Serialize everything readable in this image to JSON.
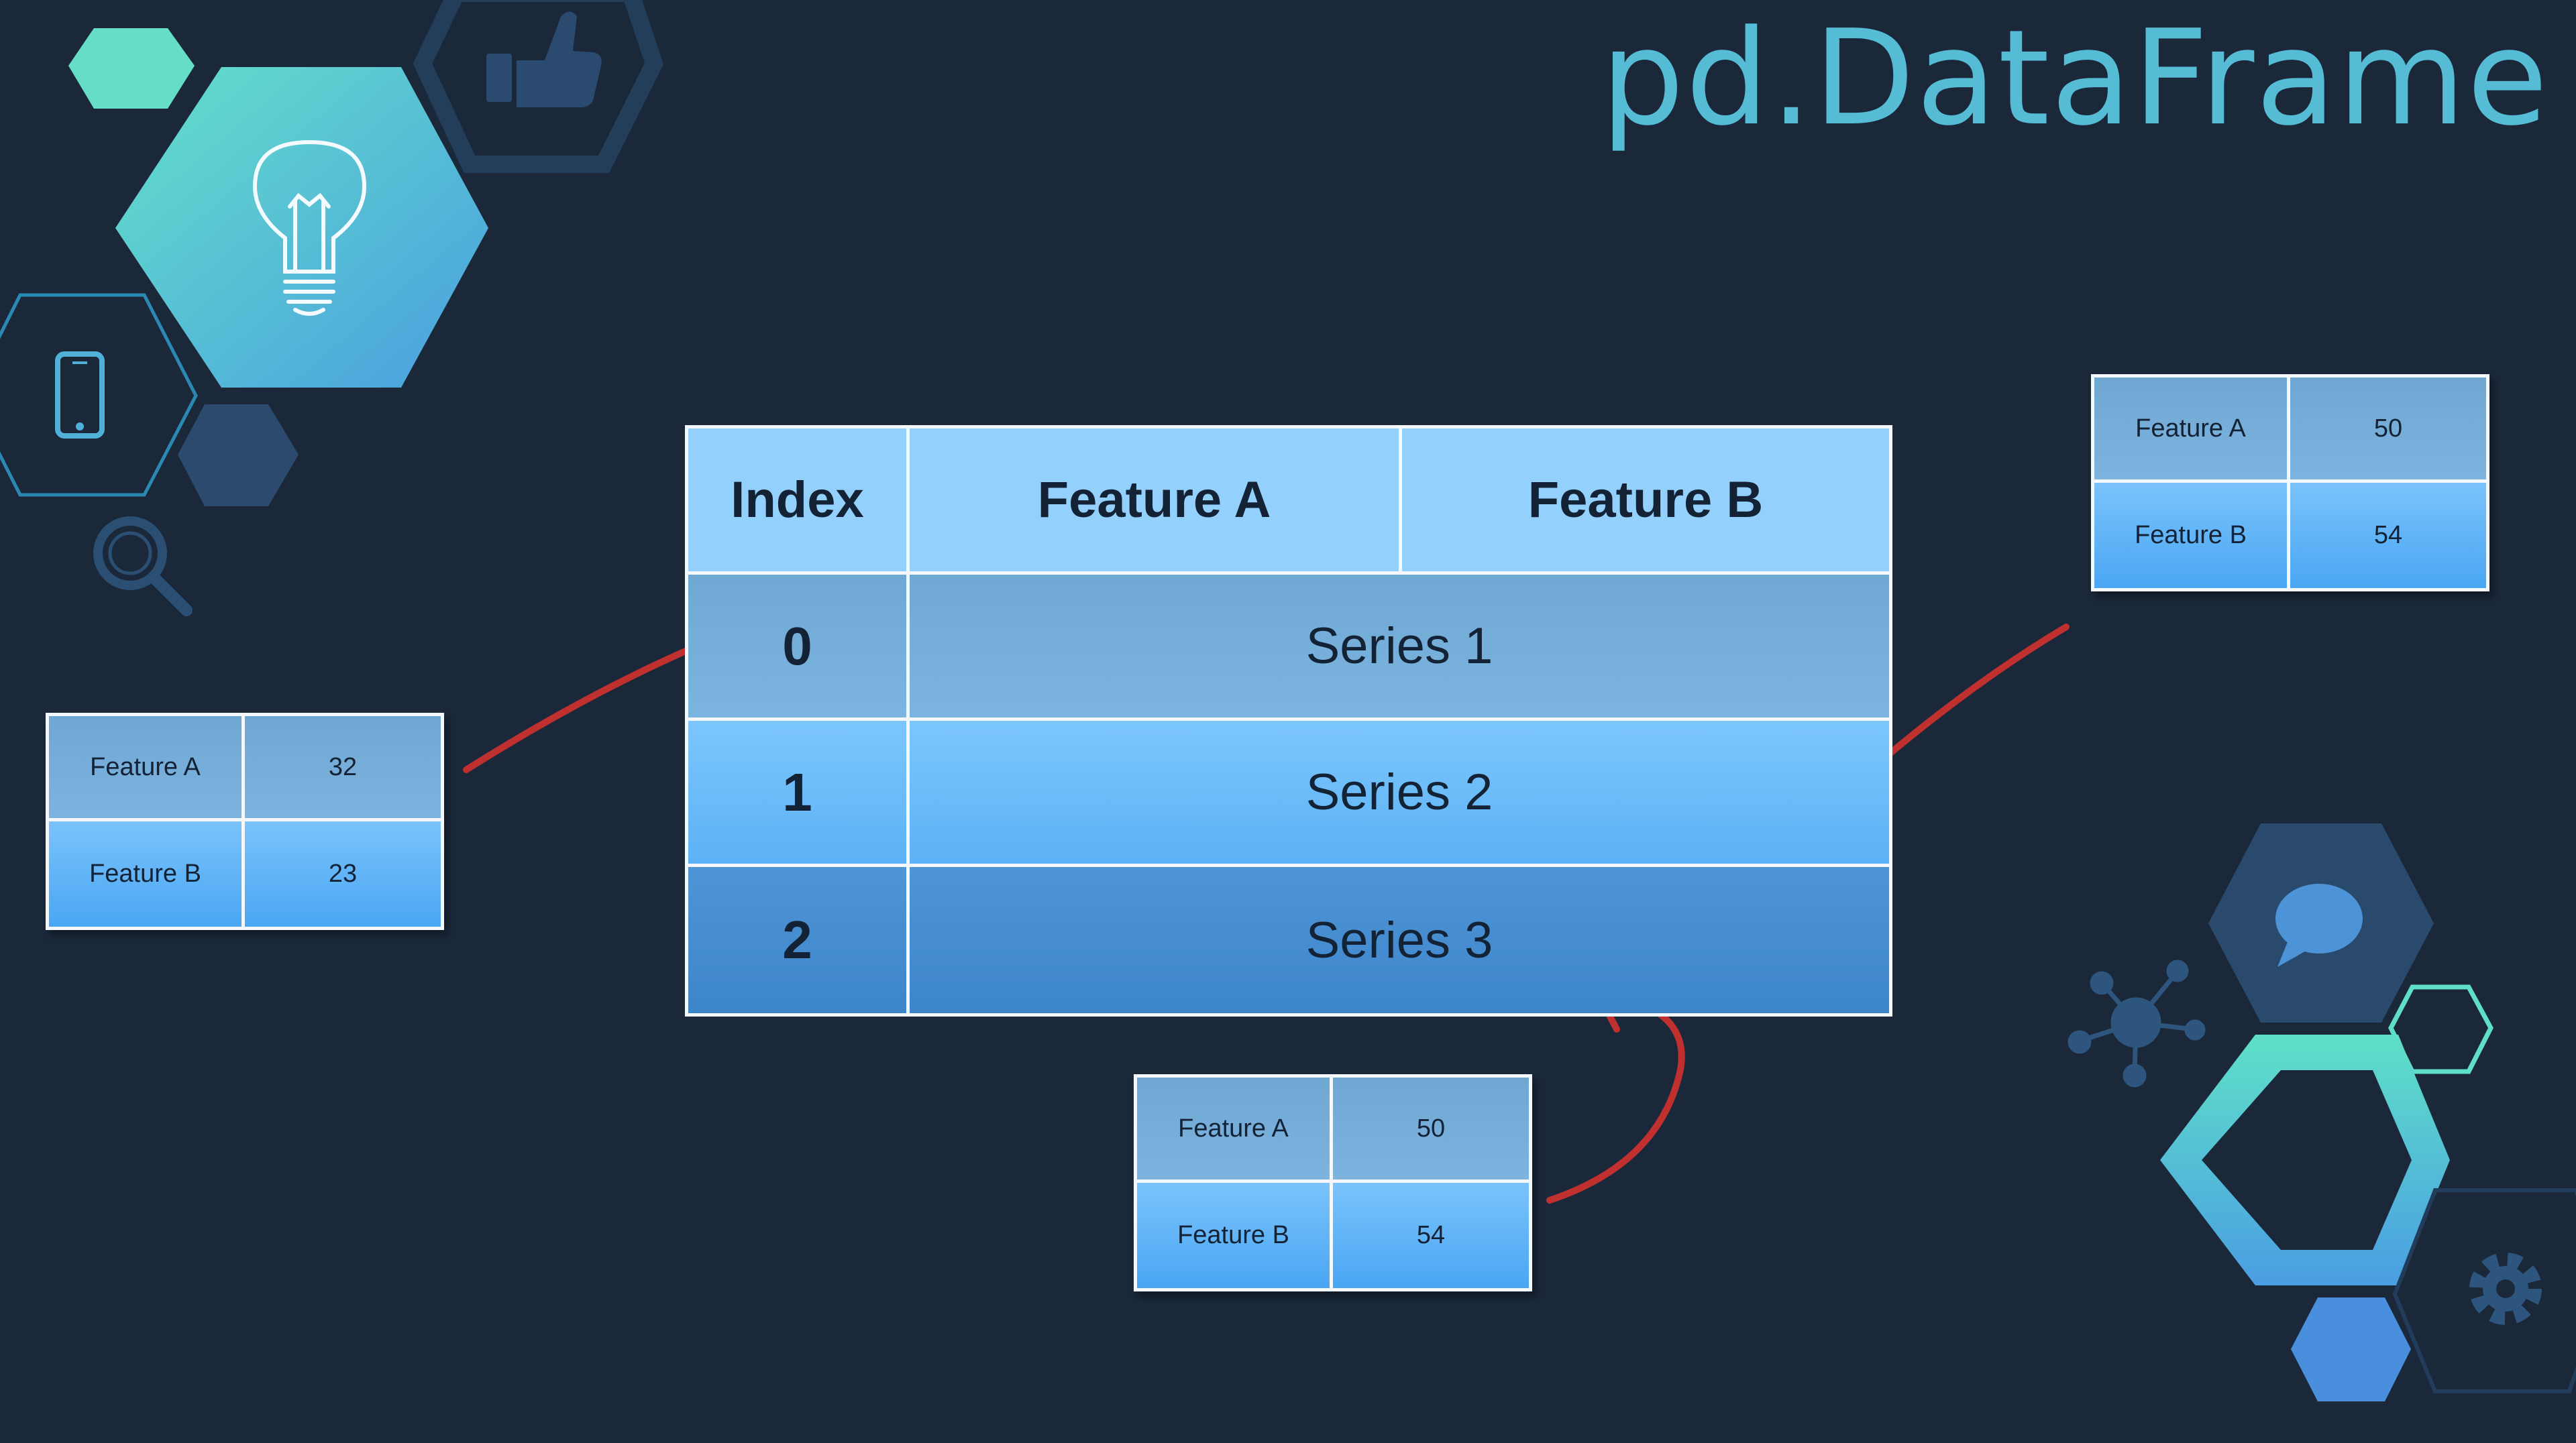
{
  "title": "pd.DataFrame",
  "dataframe": {
    "headers": [
      "Index",
      "Feature A",
      "Feature B"
    ],
    "rows": [
      {
        "index": "0",
        "label": "Series 1"
      },
      {
        "index": "1",
        "label": "Series 2"
      },
      {
        "index": "2",
        "label": "Series 3"
      }
    ]
  },
  "tables": {
    "left": {
      "rows": [
        {
          "label": "Feature A",
          "value": "32"
        },
        {
          "label": "Feature B",
          "value": "23"
        }
      ]
    },
    "right": {
      "rows": [
        {
          "label": "Feature A",
          "value": "50"
        },
        {
          "label": "Feature B",
          "value": "54"
        }
      ]
    },
    "bottom": {
      "rows": [
        {
          "label": "Feature A",
          "value": "50"
        },
        {
          "label": "Feature B",
          "value": "54"
        }
      ]
    }
  },
  "icons": [
    "lightbulb-icon",
    "thumbs-up-icon",
    "smartphone-icon",
    "magnifier-icon",
    "chat-bubble-icon",
    "network-icon",
    "gear-icon"
  ],
  "colors": {
    "background": "#1a283a",
    "title": "#56bcd6",
    "arrow": "#c0302e",
    "teal": "#5fdec8",
    "header_cell": "#93d0fb"
  }
}
